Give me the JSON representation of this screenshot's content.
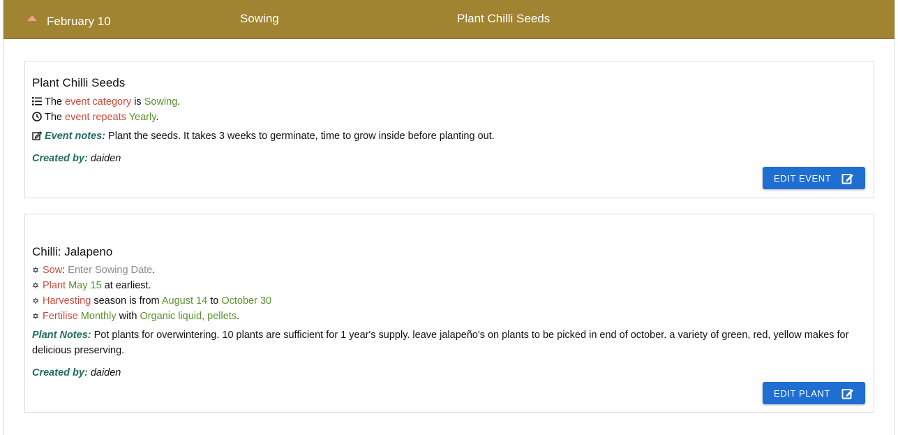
{
  "header": {
    "date": "February 10",
    "category": "Sowing",
    "title": "Plant Chilli Seeds"
  },
  "event_card": {
    "title": "Plant Chilli Seeds",
    "category_line": {
      "prefix": "The",
      "field": "event category",
      "is": "is",
      "value": "Sowing",
      "end": "."
    },
    "repeat_line": {
      "prefix": "The",
      "field": "event repeats",
      "value": "Yearly",
      "end": "."
    },
    "notes_label": "Event notes:",
    "notes": "Plant the seeds. It takes 3 weeks to germinate, time to grow inside before planting out.",
    "created_label": "Created by:",
    "created_by": "daiden",
    "edit_button": "EDIT EVENT"
  },
  "plant_card": {
    "title": "Chilli: Jalapeno",
    "sow": {
      "label": "Sow",
      "sep": ":",
      "value": "Enter Sowing Date",
      "end": "."
    },
    "plant": {
      "label": "Plant",
      "date": "May 15",
      "suffix": "at earliest."
    },
    "harvest": {
      "label": "Harvesting",
      "mid": "season is from",
      "from": "August 14",
      "to_word": "to",
      "to": "October 30"
    },
    "fertilise": {
      "label": "Fertilise",
      "freq": "Monthly",
      "with": "with",
      "product": "Organic liquid, pellets",
      "end": "."
    },
    "notes_label": "Plant Notes:",
    "notes": "Pot plants for overwintering. 10 plants are sufficient for 1 year's supply. leave jalapeño's on plants to be picked in end of october. a variety of green, red, yellow makes for delicious preserving.",
    "created_label": "Created by:",
    "created_by": "daiden",
    "edit_button": "EDIT PLANT"
  },
  "colors": {
    "header_bg": "#a08431",
    "button_bg": "#1f6ed1",
    "red_text": "#c94b3e",
    "green_text": "#58922c",
    "teal_label": "#1f6e5c"
  }
}
